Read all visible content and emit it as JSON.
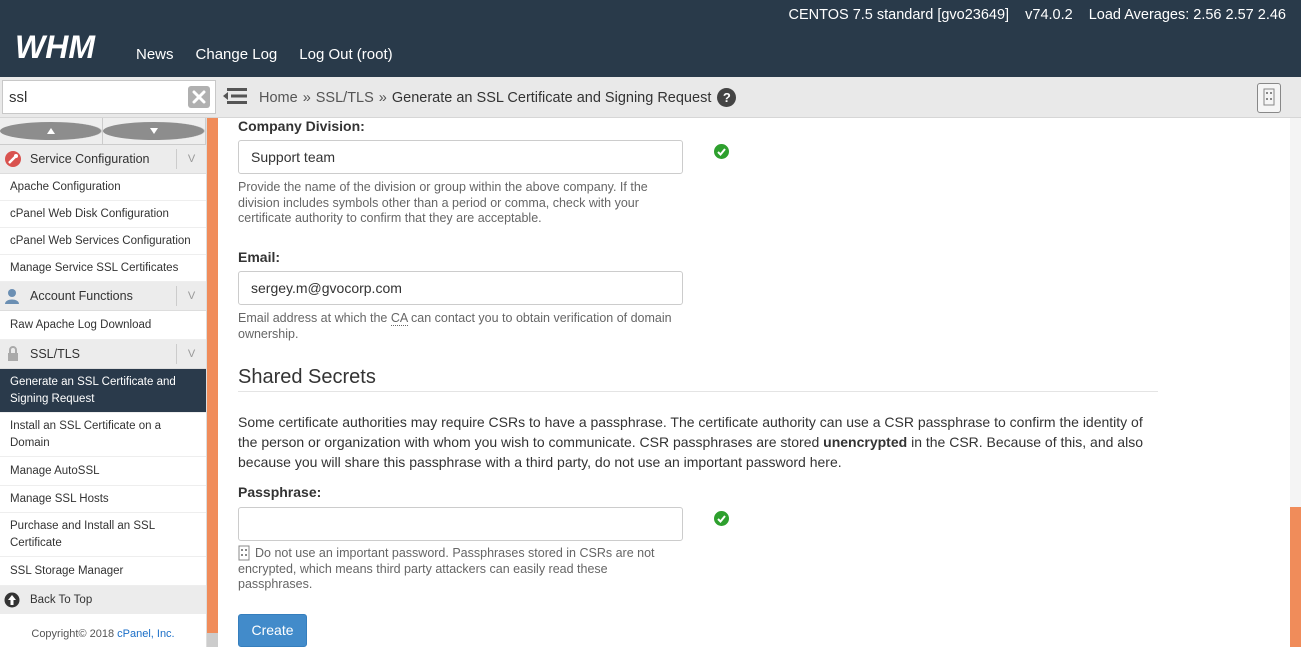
{
  "header": {
    "logo_text": "WHM",
    "nav": [
      "News",
      "Change Log",
      "Log Out (root)"
    ],
    "os": "CENTOS 7.5 standard [gvo23649]",
    "version": "v74.0.2",
    "load": "Load Averages: 2.56 2.57 2.46"
  },
  "search": {
    "value": "ssl"
  },
  "breadcrumb": {
    "home": "Home",
    "sep": "»",
    "section": "SSL/TLS",
    "current": "Generate an SSL Certificate and Signing Request",
    "help": "?"
  },
  "sidebar": {
    "categories": [
      {
        "label": "Service Configuration",
        "items": [
          "Apache Configuration",
          "cPanel Web Disk Configuration",
          "cPanel Web Services Configuration",
          "Manage Service SSL Certificates"
        ]
      },
      {
        "label": "Account Functions",
        "items": [
          "Raw Apache Log Download"
        ]
      },
      {
        "label": "SSL/TLS",
        "items": [
          "Generate an SSL Certificate and Signing Request",
          "Install an SSL Certificate on a Domain",
          "Manage AutoSSL",
          "Manage SSL Hosts",
          "Purchase and Install an SSL Certificate",
          "SSL Storage Manager"
        ]
      }
    ],
    "chevron": "V",
    "back_to_top": "Back To Top",
    "copyright_prefix": "Copyright© 2018 ",
    "copyright_link": "cPanel, Inc."
  },
  "form": {
    "division": {
      "label": "Company Division:",
      "value": "Support team",
      "help": "Provide the name of the division or group within the above company. If the division includes symbols other than a period or comma, check with your certificate authority to confirm that they are acceptable."
    },
    "email": {
      "label": "Email:",
      "value": "sergey.m@gvocorp.com",
      "help_before": "Email address at which the ",
      "help_abbr": "CA",
      "help_after": " can contact you to obtain verification of domain ownership."
    },
    "shared_secrets": {
      "title": "Shared Secrets",
      "desc_before": "Some certificate authorities may require CSRs to have a passphrase. The certificate authority can use a CSR passphrase to confirm the identity of the person or organization with whom you wish to communicate. CSR passphrases are stored ",
      "desc_bold": "unencrypted",
      "desc_after": " in the CSR. Because of this, and also because you will share this passphrase with a third party, do not use an important password here."
    },
    "passphrase": {
      "label": "Passphrase:",
      "value": "",
      "help": "Do not use an important password. Passphrases stored in CSRs are not encrypted, which means third party attackers can easily read these passphrases."
    },
    "create_button": "Create"
  },
  "colors": {
    "header_bg": "#293a4a",
    "accent": "#f08c5a",
    "button": "#428bca",
    "ok": "#2ea02e"
  }
}
